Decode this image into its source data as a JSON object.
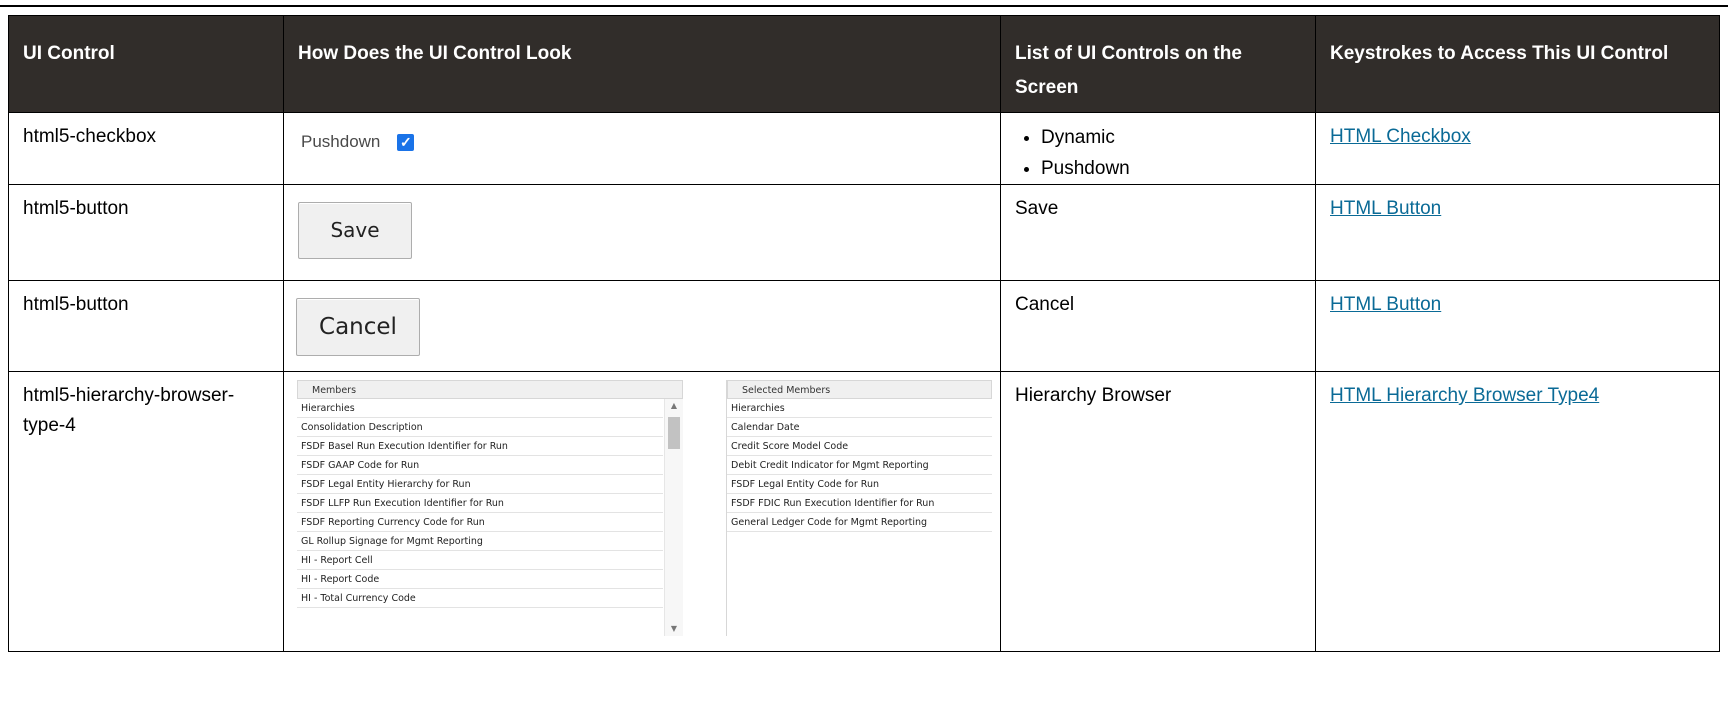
{
  "headers": [
    "UI Control",
    "How Does the UI Control Look",
    "List of UI Controls on the Screen",
    "Keystrokes to Access This UI Control"
  ],
  "rows": [
    {
      "control": "html5-checkbox",
      "list": [
        "Dynamic",
        "Pushdown"
      ],
      "link": "HTML Checkbox",
      "demo": {
        "label": "Pushdown",
        "checked": true
      }
    },
    {
      "control": "html5-button",
      "list_text": "Save",
      "link": "HTML Button",
      "demo": {
        "label": "Save"
      }
    },
    {
      "control": "html5-button",
      "list_text": "Cancel",
      "link": "HTML Button",
      "demo": {
        "label": "Cancel"
      }
    },
    {
      "control": "html5-hierarchy-browser-type-4",
      "list_text": "Hierarchy Browser",
      "link": "HTML Hierarchy Browser Type4",
      "demo": {
        "members_title": "Members",
        "members": [
          "Hierarchies",
          "Consolidation Description",
          "FSDF Basel Run Execution Identifier for Run",
          "FSDF GAAP Code for Run",
          "FSDF Legal Entity Hierarchy for Run",
          "FSDF LLFP Run Execution Identifier for Run",
          "FSDF Reporting Currency Code for Run",
          "GL Rollup Signage for Mgmt Reporting",
          "HI - Report Cell",
          "HI - Report Code",
          "HI - Total Currency Code"
        ],
        "selected_title": "Selected Members",
        "selected": [
          "Hierarchies",
          "Calendar Date",
          "Credit Score Model Code",
          "Debit Credit Indicator for Mgmt Reporting",
          "FSDF Legal Entity Code for Run",
          "FSDF FDIC Run Execution Identifier for Run",
          "General Ledger Code for Mgmt Reporting"
        ]
      }
    }
  ]
}
